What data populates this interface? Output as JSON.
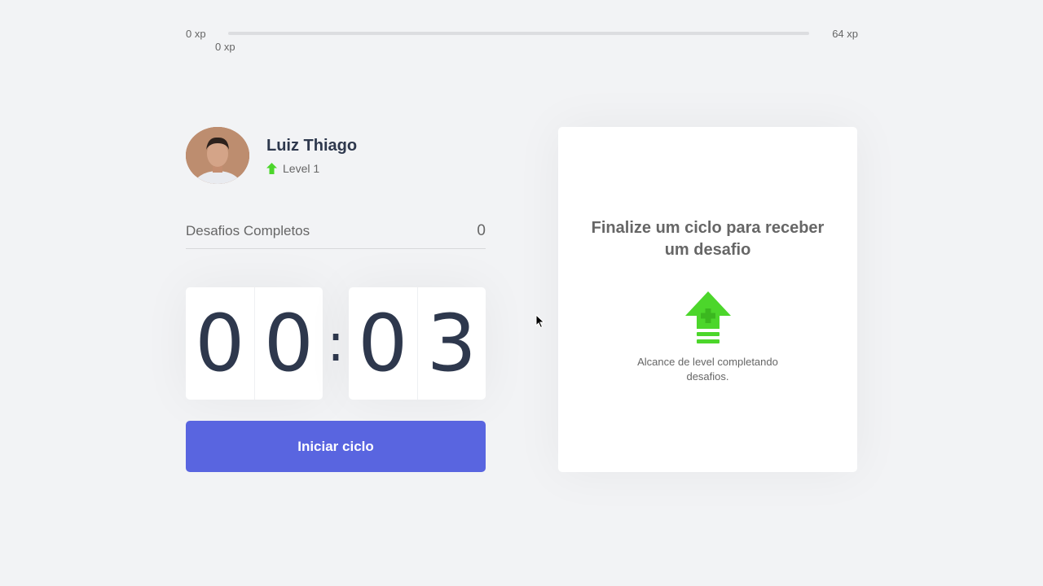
{
  "xp": {
    "min_label": "0 xp",
    "max_label": "64 xp",
    "current_label": "0 xp",
    "progress": 0
  },
  "profile": {
    "name": "Luiz Thiago",
    "level_label": "Level 1",
    "level_icon": "level-up-arrow-icon"
  },
  "challenges": {
    "completed_label": "Desafios Completos",
    "completed_value": "0"
  },
  "countdown": {
    "minutes": [
      "0",
      "0"
    ],
    "separator": ":",
    "seconds": [
      "0",
      "3"
    ]
  },
  "actions": {
    "start_label": "Iniciar ciclo"
  },
  "challenge_box": {
    "title": "Finalize um ciclo para receber um desafio",
    "icon": "level-up-icon",
    "hint": "Alcance de level completando desafios."
  },
  "colors": {
    "accent": "#5965e0",
    "green": "#4cd62b",
    "title": "#2e384d",
    "text": "#666666",
    "background": "#f2f3f5"
  }
}
